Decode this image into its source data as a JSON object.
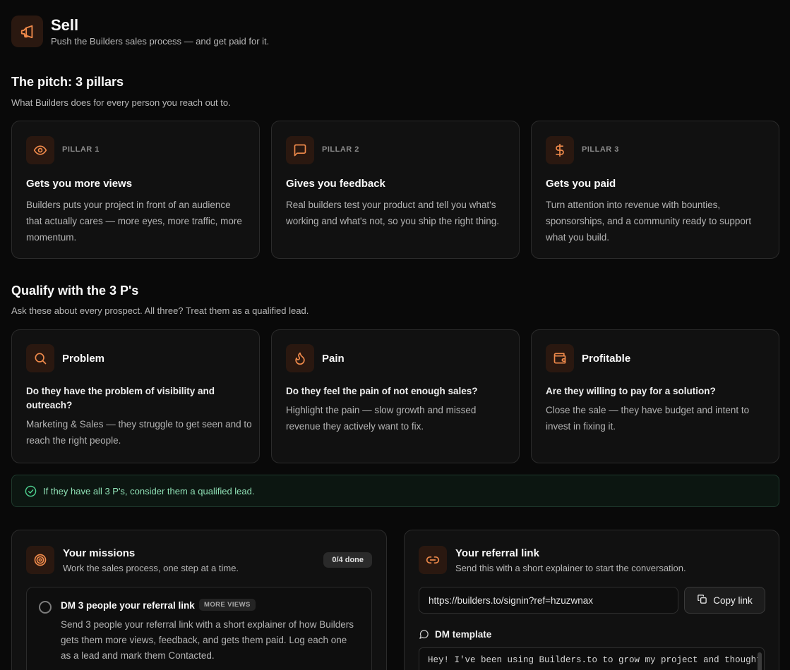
{
  "header": {
    "icon": "megaphone-icon",
    "title": "Sell",
    "subtitle": "Push the Builders sales process — and get paid for it."
  },
  "pitch": {
    "title": "The pitch: 3 pillars",
    "subtitle": "What Builders does for every person you reach out to.",
    "pillars": [
      {
        "icon": "eye-icon",
        "label": "PILLAR 1",
        "title": "Gets you more views",
        "desc": "Builders puts your project in front of an audience that actually cares — more eyes, more traffic, more momentum."
      },
      {
        "icon": "message-square-icon",
        "label": "PILLAR 2",
        "title": "Gives you feedback",
        "desc": "Real builders test your product and tell you what's working and what's not, so you ship the right thing."
      },
      {
        "icon": "dollar-icon",
        "label": "PILLAR 3",
        "title": "Gets you paid",
        "desc": "Turn attention into revenue with bounties, sponsorships, and a community ready to support what you build."
      }
    ]
  },
  "qualify": {
    "title": "Qualify with the 3 P's",
    "subtitle": "Ask these about every prospect. All three? Treat them as a qualified lead.",
    "items": [
      {
        "icon": "search-icon",
        "title": "Problem",
        "question": "Do they have the problem of visibility and outreach?",
        "desc": "Marketing & Sales — they struggle to get seen and to reach the right people."
      },
      {
        "icon": "flame-icon",
        "title": "Pain",
        "question": "Do they feel the pain of not enough sales?",
        "desc": "Highlight the pain — slow growth and missed revenue they actively want to fix."
      },
      {
        "icon": "wallet-icon",
        "title": "Profitable",
        "question": "Are they willing to pay for a solution?",
        "desc": "Close the sale — they have budget and intent to invest in fixing it."
      }
    ],
    "banner": "If they have all 3 P's, consider them a qualified lead."
  },
  "missions": {
    "icon": "target-icon",
    "title": "Your missions",
    "subtitle": "Work the sales process, one step at a time.",
    "badge": "0/4 done",
    "items": [
      {
        "title": "DM 3 people your referral link",
        "tag": "MORE VIEWS",
        "desc": "Send 3 people your referral link with a short explainer of how Builders gets them more views, feedback, and gets them paid. Log each one as a lead and mark them Contacted.",
        "done": false
      }
    ]
  },
  "referral": {
    "icon": "link-icon",
    "title": "Your referral link",
    "subtitle": "Send this with a short explainer to start the conversation.",
    "url": "https://builders.to/signin?ref=hzuzwnax",
    "copy_label": "Copy link",
    "dm_label": "DM template",
    "dm_text": "Hey! I've been using Builders.to to grow my project and thought"
  },
  "colors": {
    "accent": "#f08a4b",
    "icon_bg": "#2a1810",
    "success": "#4ed190",
    "background": "#090909",
    "card": "#111111"
  }
}
